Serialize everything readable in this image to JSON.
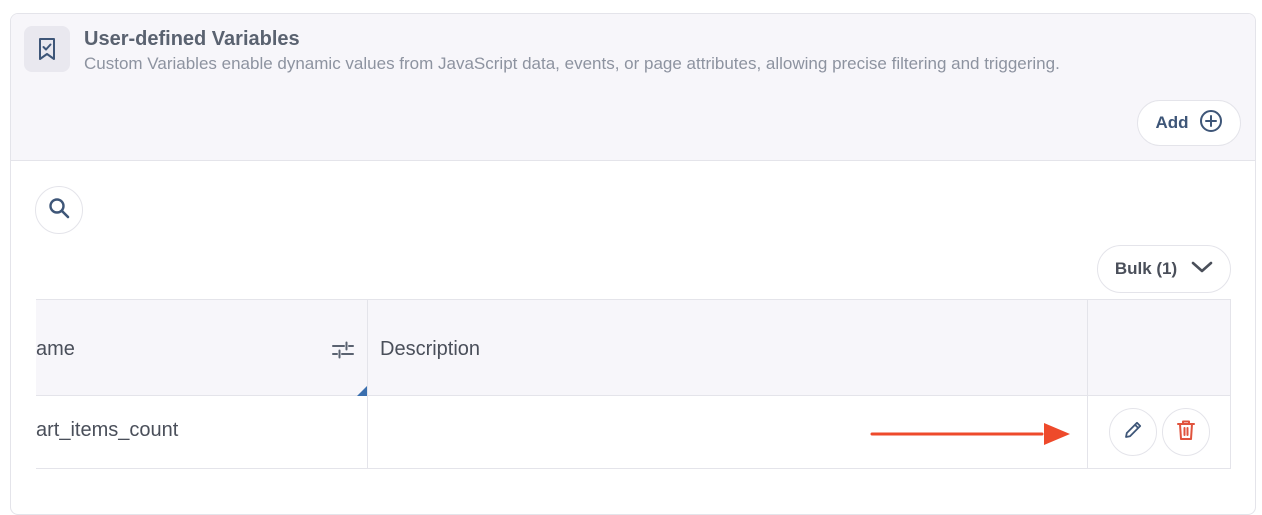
{
  "header": {
    "title": "User-defined Variables",
    "subtitle": "Custom Variables enable dynamic values from JavaScript data, events, or page attributes, allowing precise filtering and triggering.",
    "add_label": "Add"
  },
  "toolbar": {
    "bulk_label": "Bulk (1)"
  },
  "table": {
    "columns": [
      {
        "label": "ame"
      },
      {
        "label": "Description"
      },
      {
        "label": ""
      }
    ],
    "rows": [
      {
        "name": "art_items_count",
        "description": ""
      }
    ]
  },
  "colors": {
    "header_bg": "#f7f6fa",
    "accent": "#3e5678",
    "delete": "#e0533d",
    "annotation_arrow": "#ee4a2b"
  },
  "icons": [
    "bookmark-check-icon",
    "plus-circle-icon",
    "search-icon",
    "chevron-down-icon",
    "sliders-icon",
    "pencil-icon",
    "trash-icon"
  ]
}
